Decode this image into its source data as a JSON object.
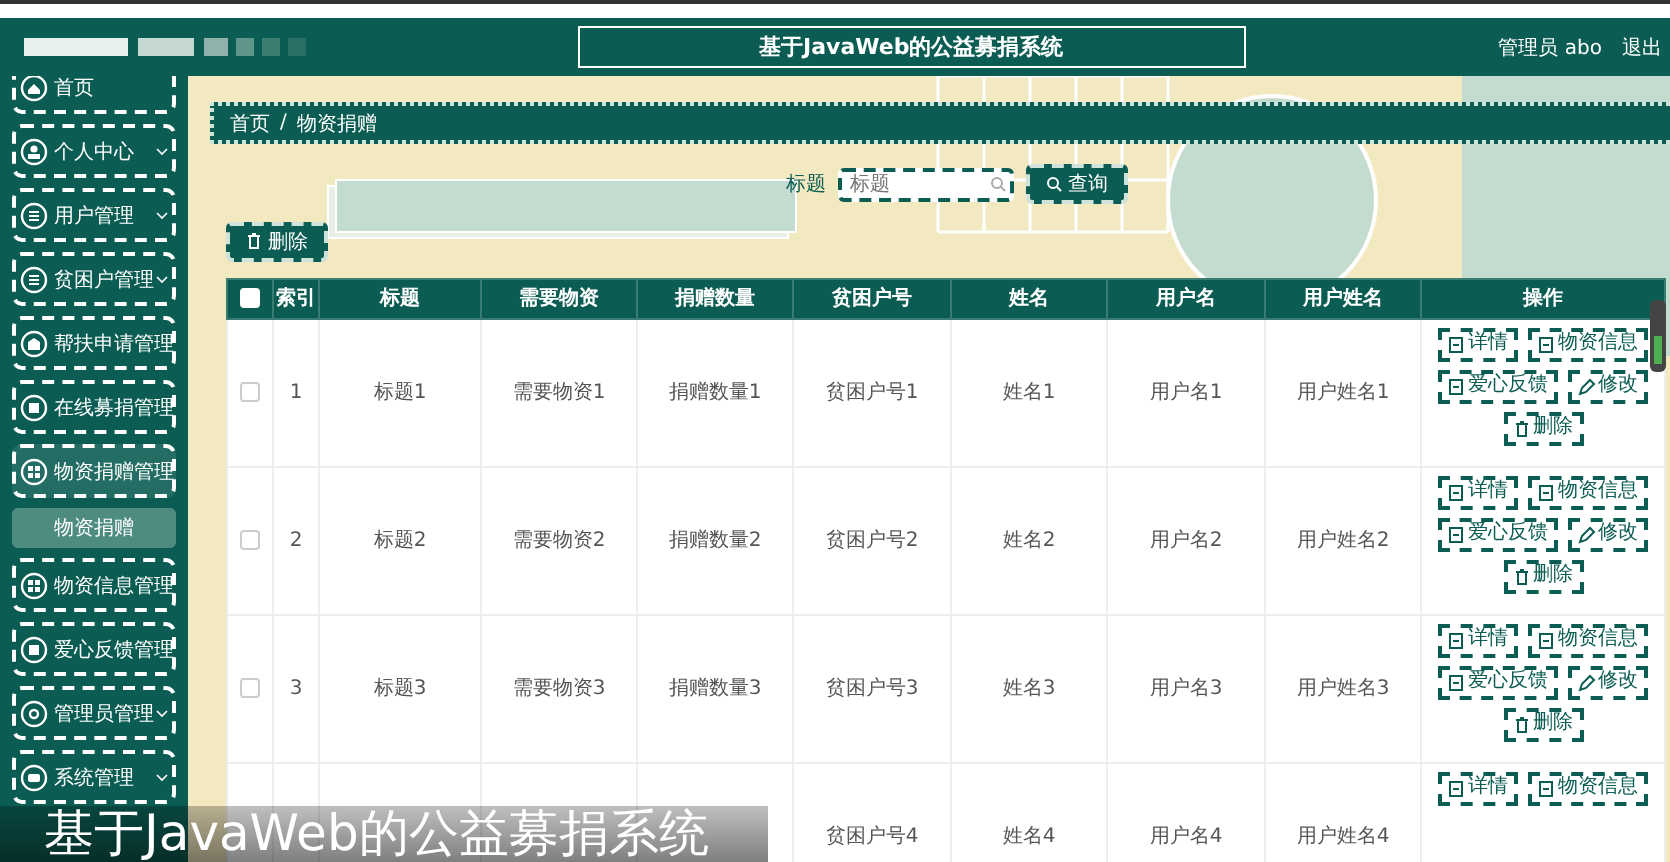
{
  "header": {
    "title": "基于JavaWeb的公益募捐系统",
    "user": "管理员 abo",
    "logout": "退出"
  },
  "sidebar": {
    "items": [
      {
        "label": "首页",
        "chevron": false,
        "expanded": false
      },
      {
        "label": "个人中心",
        "chevron": true,
        "expanded": false
      },
      {
        "label": "用户管理",
        "chevron": true,
        "expanded": false
      },
      {
        "label": "贫困户管理",
        "chevron": true,
        "expanded": false
      },
      {
        "label": "帮扶申请管理",
        "chevron": false,
        "expanded": false
      },
      {
        "label": "在线募捐管理",
        "chevron": false,
        "expanded": false
      },
      {
        "label": "物资捐赠管理",
        "chevron": false,
        "expanded": true,
        "children": [
          {
            "label": "物资捐赠",
            "selected": true
          }
        ]
      },
      {
        "label": "物资信息管理",
        "chevron": false,
        "expanded": false
      },
      {
        "label": "爱心反馈管理",
        "chevron": false,
        "expanded": false
      },
      {
        "label": "管理员管理",
        "chevron": true,
        "expanded": false
      },
      {
        "label": "系统管理",
        "chevron": true,
        "expanded": false
      }
    ]
  },
  "breadcrumb": {
    "items": [
      "首页",
      "物资捐赠"
    ],
    "separator": "/"
  },
  "search": {
    "label": "标题",
    "placeholder": "标题",
    "button": "查询"
  },
  "toolbar": {
    "delete_button": "删除"
  },
  "table": {
    "header_checked": false,
    "columns": [
      "索引",
      "标题",
      "需要物资",
      "捐赠数量",
      "贫困户号",
      "姓名",
      "用户名",
      "用户姓名",
      "操作"
    ],
    "rows": [
      {
        "checked": false,
        "cells": [
          "1",
          "标题1",
          "需要物资1",
          "捐赠数量1",
          "贫困户号1",
          "姓名1",
          "用户名1",
          "用户姓名1"
        ],
        "actions": [
          {
            "label": "详情",
            "kind": "view"
          },
          {
            "label": "物资信息",
            "kind": "view"
          },
          {
            "label": "爱心反馈",
            "kind": "view"
          },
          {
            "label": "修改",
            "kind": "edit"
          },
          {
            "label": "删除",
            "kind": "delete"
          }
        ]
      },
      {
        "checked": false,
        "cells": [
          "2",
          "标题2",
          "需要物资2",
          "捐赠数量2",
          "贫困户号2",
          "姓名2",
          "用户名2",
          "用户姓名2"
        ],
        "actions": [
          {
            "label": "详情",
            "kind": "view"
          },
          {
            "label": "物资信息",
            "kind": "view"
          },
          {
            "label": "爱心反馈",
            "kind": "view"
          },
          {
            "label": "修改",
            "kind": "edit"
          },
          {
            "label": "删除",
            "kind": "delete"
          }
        ]
      },
      {
        "checked": false,
        "cells": [
          "3",
          "标题3",
          "需要物资3",
          "捐赠数量3",
          "贫困户号3",
          "姓名3",
          "用户名3",
          "用户姓名3"
        ],
        "actions": [
          {
            "label": "详情",
            "kind": "view"
          },
          {
            "label": "物资信息",
            "kind": "view"
          },
          {
            "label": "爱心反馈",
            "kind": "view"
          },
          {
            "label": "修改",
            "kind": "edit"
          },
          {
            "label": "删除",
            "kind": "delete"
          }
        ]
      },
      {
        "cells": [
          null,
          null,
          null,
          null,
          "贫困户号4",
          "姓名4",
          "用户名4",
          "用户姓名4"
        ],
        "actions": [
          {
            "label": "详情",
            "kind": "view"
          },
          {
            "label": "物资信息",
            "kind": "view"
          }
        ]
      }
    ]
  },
  "caption": "基于JavaWeb的公益募捐系统"
}
